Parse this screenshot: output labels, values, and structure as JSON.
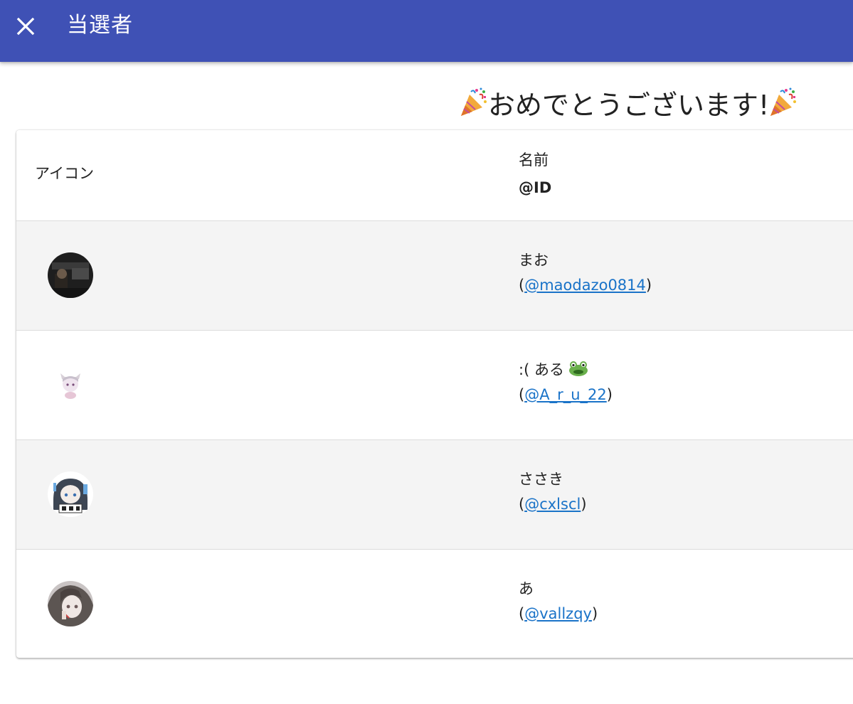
{
  "app_bar": {
    "title": "当選者",
    "close_icon": "close-icon",
    "color": "#3f51b5"
  },
  "congrats": {
    "text": "おめでとうございます!",
    "icon": "party-popper-icon"
  },
  "table": {
    "headers": {
      "icon": "アイコン",
      "name": "名前",
      "id": "@ID"
    },
    "rows": [
      {
        "name": "まお",
        "name_emoji": "",
        "handle": "@maodazo0814",
        "open_paren": "(",
        "close_paren": ")"
      },
      {
        "name": ":( ある",
        "name_emoji": "frog-icon",
        "handle": "@A_r_u_22",
        "open_paren": "(",
        "close_paren": ")"
      },
      {
        "name": "ささき",
        "name_emoji": "",
        "handle": "@cxlscl",
        "open_paren": "(",
        "close_paren": ")"
      },
      {
        "name": "あ",
        "name_emoji": "",
        "handle": "@vallzqy",
        "open_paren": "(",
        "close_paren": ")"
      }
    ]
  },
  "colors": {
    "link": "#1a73c8",
    "row_alt": "#f4f4f4"
  }
}
